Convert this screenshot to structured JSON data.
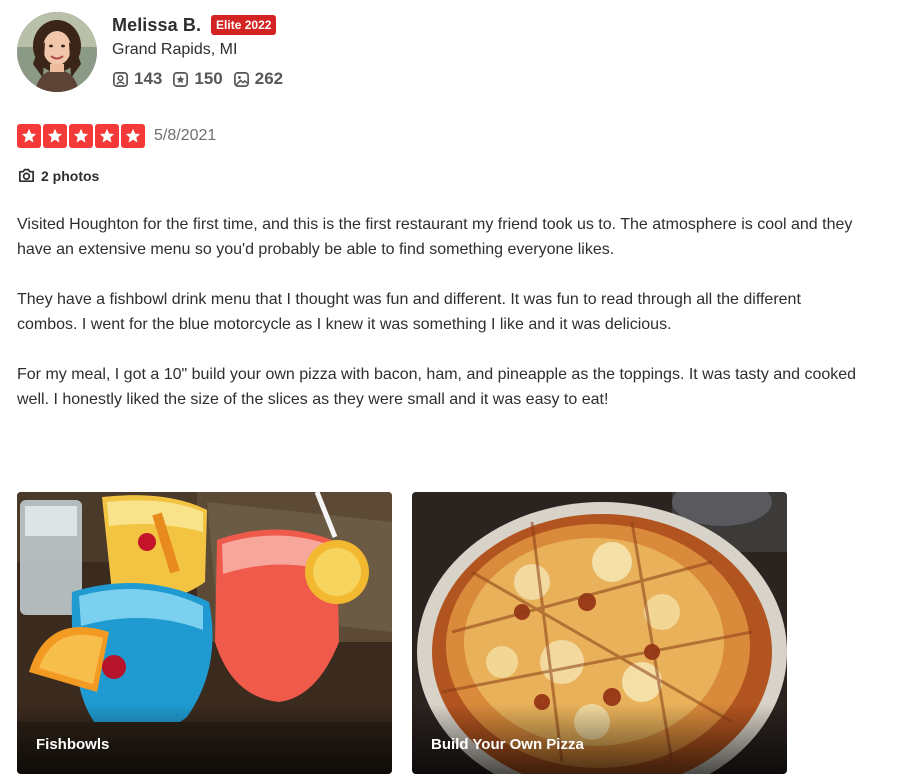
{
  "user": {
    "name": "Melissa B.",
    "elite_badge": "Elite 2022",
    "location": "Grand Rapids, MI",
    "stats": {
      "friends": "143",
      "reviews": "150",
      "photos": "262"
    }
  },
  "review": {
    "rating": 5,
    "rating_max": 5,
    "date": "5/8/2021",
    "photos_link": "2 photos",
    "paragraphs": [
      "Visited Houghton for the first time, and this is the first restaurant my friend took us to. The atmosphere is cool and they have an extensive menu so you'd probably be able to find something everyone likes.",
      "They have a fishbowl drink menu that I thought was fun and different. It was fun to read through all the different combos. I went for the blue motorcycle as I knew it was something I like and it was delicious.",
      "For my meal, I got a 10\" build your own pizza with bacon, ham, and pineapple as the toppings. It was tasty and cooked well. I honestly liked the size of the slices as they were small and it was easy to eat!"
    ],
    "photos": [
      {
        "caption": "Fishbowls"
      },
      {
        "caption": "Build Your Own Pizza"
      }
    ]
  },
  "icons": {
    "friends": "friends-icon",
    "reviews": "review-star-icon",
    "photos": "photo-icon",
    "camera": "camera-icon",
    "star": "star-icon"
  },
  "colors": {
    "star_red": "#f43939",
    "elite_red": "#d32323",
    "text": "#2d2e2f",
    "muted": "#6e7072"
  }
}
